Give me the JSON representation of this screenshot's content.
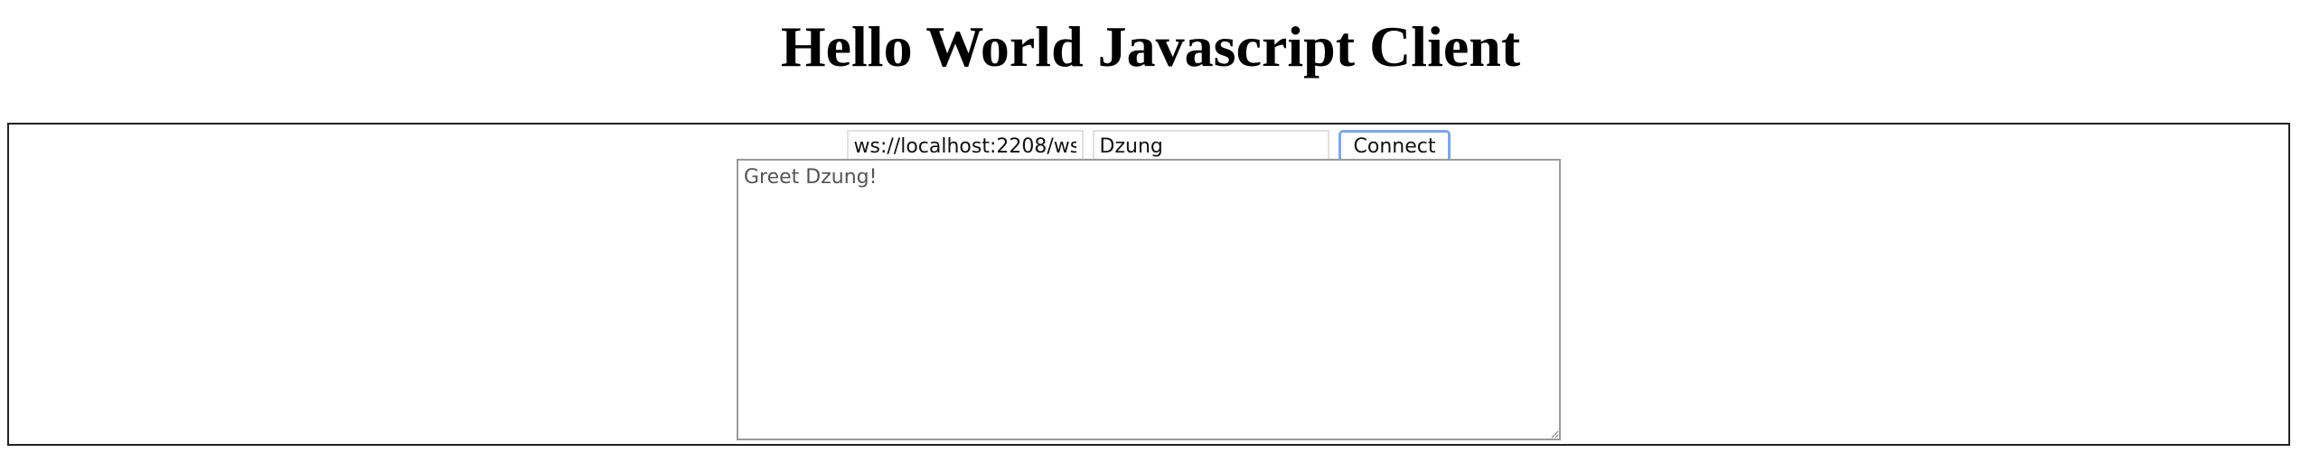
{
  "header": {
    "title": "Hello World Javascript Client"
  },
  "form": {
    "url_value": "ws://localhost:2208/ws",
    "name_value": "Dzung",
    "connect_label": "Connect"
  },
  "output": {
    "text": "Greet Dzung!"
  },
  "colors": {
    "frame_border": "#222222",
    "button_focus_ring": "#7aa8ea",
    "textarea_border": "#9a9a9a"
  }
}
